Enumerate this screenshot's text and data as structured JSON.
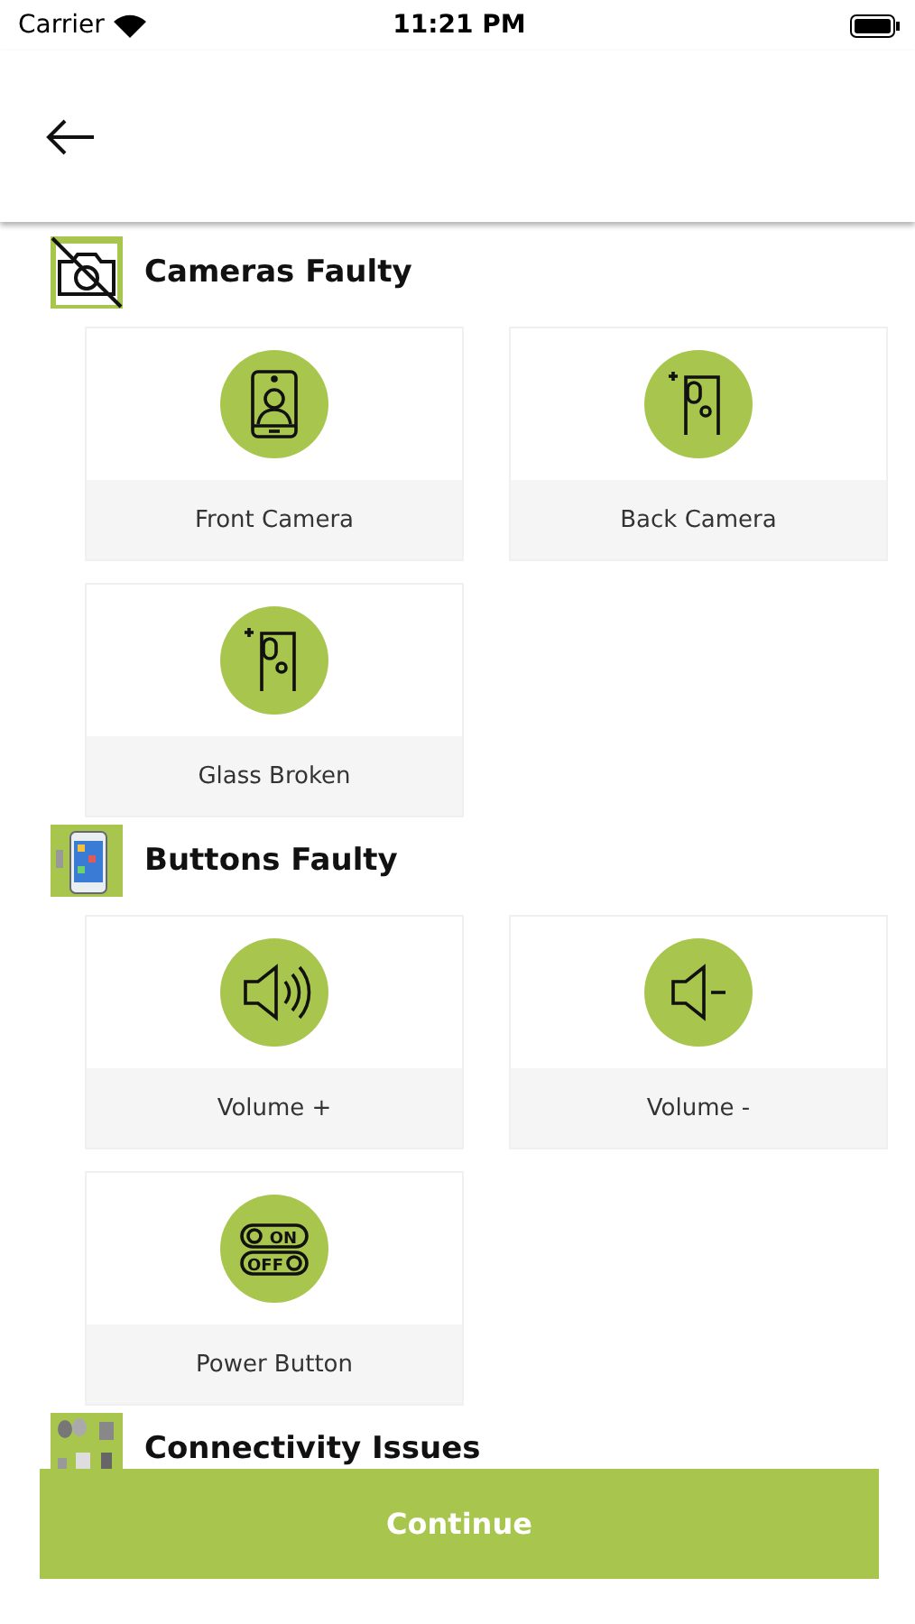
{
  "status_bar": {
    "carrier": "Carrier",
    "time": "11:21 PM"
  },
  "sections": [
    {
      "title": "Cameras Faulty",
      "kind": "camera",
      "items": [
        {
          "label": "Front Camera",
          "kind": "selfie"
        },
        {
          "label": "Back Camera",
          "kind": "rear"
        },
        {
          "label": "Glass Broken",
          "kind": "rear"
        }
      ]
    },
    {
      "title": "Buttons Faulty",
      "kind": "phone",
      "items": [
        {
          "label": "Volume +",
          "kind": "louder"
        },
        {
          "label": "Volume -",
          "kind": "quieter"
        },
        {
          "label": "Power Button",
          "kind": "switch",
          "icon_texts": [
            "ON",
            "OFF"
          ]
        }
      ]
    },
    {
      "title": "Connectivity Issues",
      "kind": "devices"
    }
  ],
  "continue_button": "Continue"
}
